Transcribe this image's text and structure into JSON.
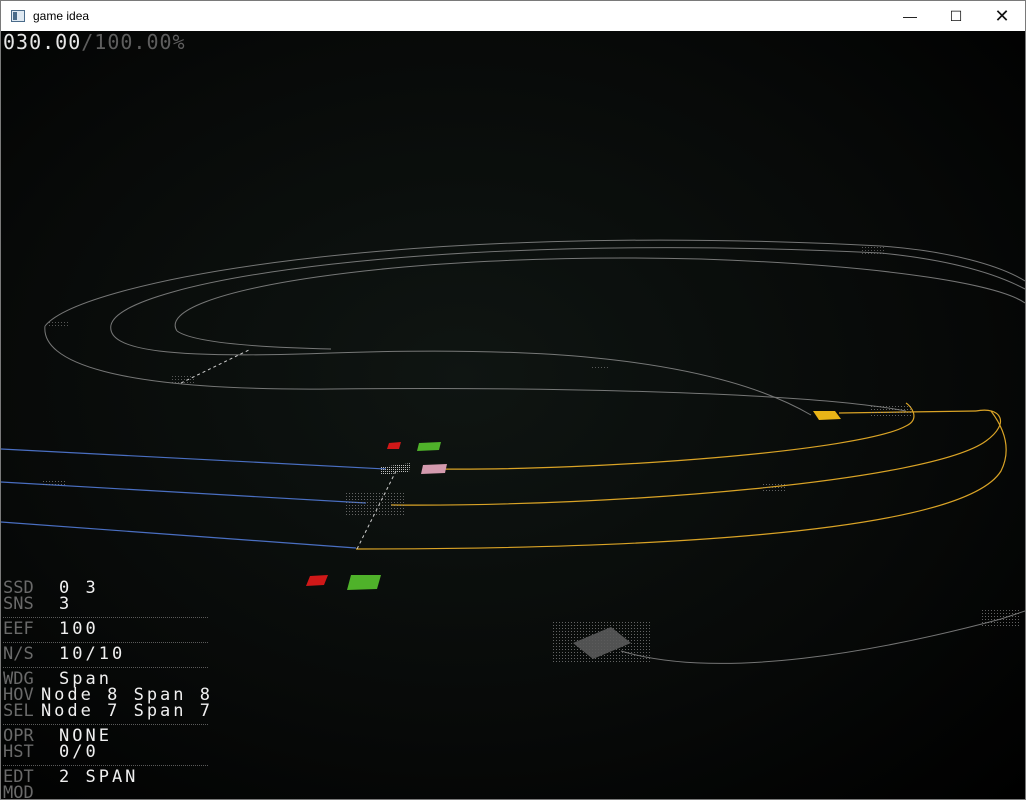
{
  "window": {
    "title": "game idea",
    "minimize_glyph": "—",
    "maximize_glyph": "☐",
    "close_glyph": "✕"
  },
  "progress": {
    "current": "030.00",
    "total": "/100.00%"
  },
  "hud": {
    "groups": [
      [
        {
          "key": "SSD",
          "value": "0 3"
        },
        {
          "key": "SNS",
          "value": "3"
        }
      ],
      [
        {
          "key": "EEF",
          "value": "100"
        }
      ],
      [
        {
          "key": "N/S",
          "value": "10/10"
        }
      ],
      [
        {
          "key": "WDG",
          "value": "Span"
        },
        {
          "key": "HOV",
          "value": "Node 8 Span 8"
        },
        {
          "key": "SEL",
          "value": "Node 7 Span 7"
        }
      ],
      [
        {
          "key": "OPR",
          "value": "NONE"
        },
        {
          "key": "HST",
          "value": "0/0"
        }
      ],
      [
        {
          "key": "EDT",
          "value": "2 SPAN"
        },
        {
          "key": "MOD",
          "value": ""
        }
      ]
    ]
  },
  "colors": {
    "track_gray": "#9a9a9a",
    "track_blue": "#4a6fc2",
    "track_orange": "#d9a326",
    "marker_red": "#d01818",
    "marker_green": "#4fb22a",
    "marker_pink": "#d49aae",
    "marker_yellow": "#e8b417"
  }
}
